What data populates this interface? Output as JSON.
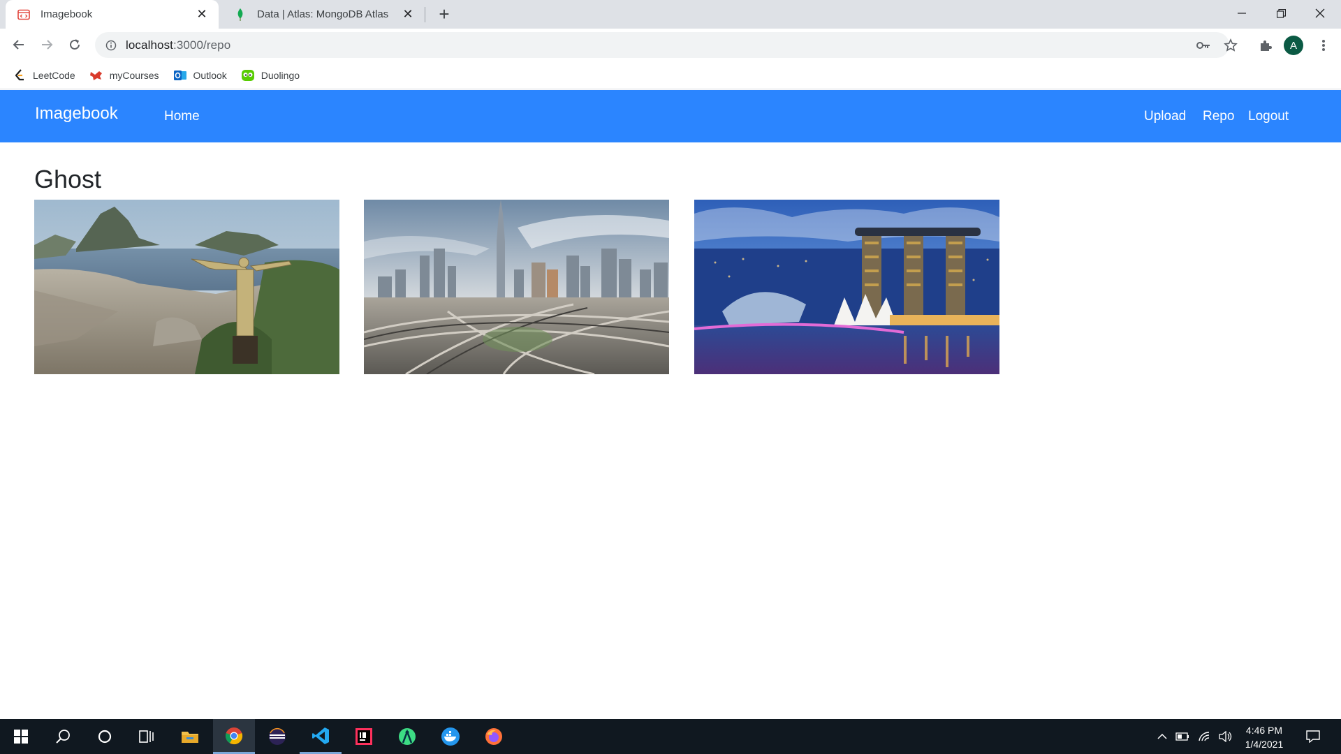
{
  "browser": {
    "tabs": [
      {
        "title": "Imagebook",
        "favicon": "code-page-icon",
        "active": true
      },
      {
        "title": "Data | Atlas: MongoDB Atlas",
        "favicon": "mongodb-leaf-icon",
        "active": false
      }
    ],
    "address": {
      "host": "localhost",
      "path": ":3000/repo"
    },
    "profile_initial": "A",
    "bookmarks": [
      {
        "label": "LeetCode",
        "icon": "leetcode-icon"
      },
      {
        "label": "myCourses",
        "icon": "mycourses-icon"
      },
      {
        "label": "Outlook",
        "icon": "outlook-icon"
      },
      {
        "label": "Duolingo",
        "icon": "duolingo-icon"
      }
    ]
  },
  "app": {
    "brand": "Imagebook",
    "nav_left": [
      "Home"
    ],
    "nav_right": [
      "Upload",
      "Repo",
      "Logout"
    ],
    "accent": "#2b85ff",
    "repo_owner": "Ghost",
    "images": [
      {
        "subject": "Rio de Janeiro Christ the Redeemer aerial view"
      },
      {
        "subject": "Dubai skyline with highway interchange"
      },
      {
        "subject": "Singapore Marina Bay Sands at night"
      }
    ]
  },
  "taskbar": {
    "apps": [
      "windows-start-icon",
      "search-icon",
      "cortana-icon",
      "task-view-icon",
      "file-explorer-icon",
      "chrome-icon",
      "eclipse-icon",
      "vscode-icon",
      "intellij-icon",
      "android-studio-icon",
      "docker-icon",
      "firefox-icon"
    ],
    "time": "4:46 PM",
    "date": "1/4/2021"
  }
}
